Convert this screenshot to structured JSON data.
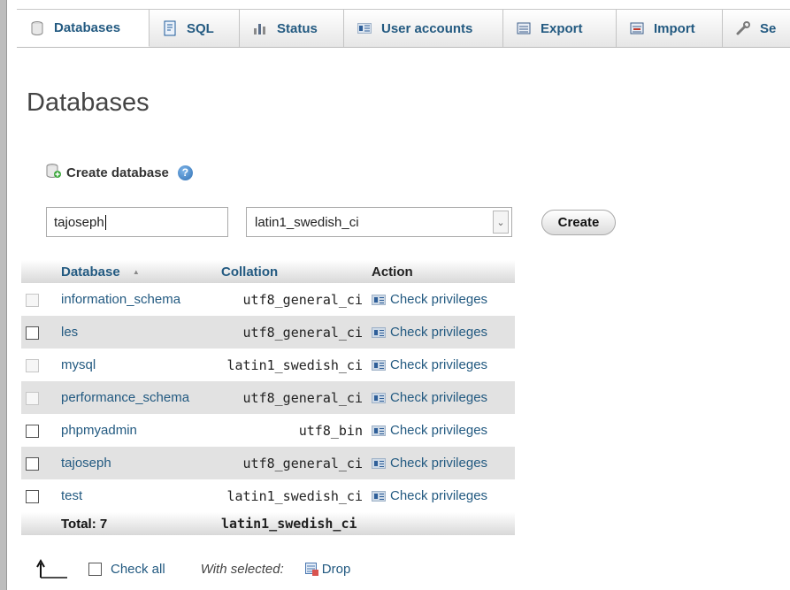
{
  "tabs": [
    {
      "label": "Databases",
      "icon": "database-icon",
      "active": true
    },
    {
      "label": "SQL",
      "icon": "sql-icon",
      "active": false
    },
    {
      "label": "Status",
      "icon": "status-chart-icon",
      "active": false
    },
    {
      "label": "User accounts",
      "icon": "user-accounts-icon",
      "active": false
    },
    {
      "label": "Export",
      "icon": "export-icon",
      "active": false
    },
    {
      "label": "Import",
      "icon": "import-icon",
      "active": false
    },
    {
      "label": "Se",
      "icon": "settings-wrench-icon",
      "active": false
    }
  ],
  "page_title": "Databases",
  "create": {
    "heading": "Create database",
    "db_name_value": "tajoseph",
    "collation_selected": "latin1_swedish_ci",
    "button_label": "Create"
  },
  "table": {
    "headers": {
      "database": "Database",
      "sort_indicator": "▲",
      "collation": "Collation",
      "action": "Action"
    },
    "rows": [
      {
        "name": "information_schema",
        "collation": "utf8_general_ci",
        "action": "Check privileges",
        "checkbox_enabled": false
      },
      {
        "name": "les",
        "collation": "utf8_general_ci",
        "action": "Check privileges",
        "checkbox_enabled": true
      },
      {
        "name": "mysql",
        "collation": "latin1_swedish_ci",
        "action": "Check privileges",
        "checkbox_enabled": false
      },
      {
        "name": "performance_schema",
        "collation": "utf8_general_ci",
        "action": "Check privileges",
        "checkbox_enabled": false
      },
      {
        "name": "phpmyadmin",
        "collation": "utf8_bin",
        "action": "Check privileges",
        "checkbox_enabled": true
      },
      {
        "name": "tajoseph",
        "collation": "utf8_general_ci",
        "action": "Check privileges",
        "checkbox_enabled": true
      },
      {
        "name": "test",
        "collation": "latin1_swedish_ci",
        "action": "Check privileges",
        "checkbox_enabled": true
      }
    ],
    "total_label": "Total: 7",
    "total_collation": "latin1_swedish_ci"
  },
  "footer": {
    "check_all": "Check all",
    "with_selected": "With selected:",
    "drop": "Drop"
  },
  "colors": {
    "link": "#235a81",
    "row_even": "#e2e2e2"
  }
}
